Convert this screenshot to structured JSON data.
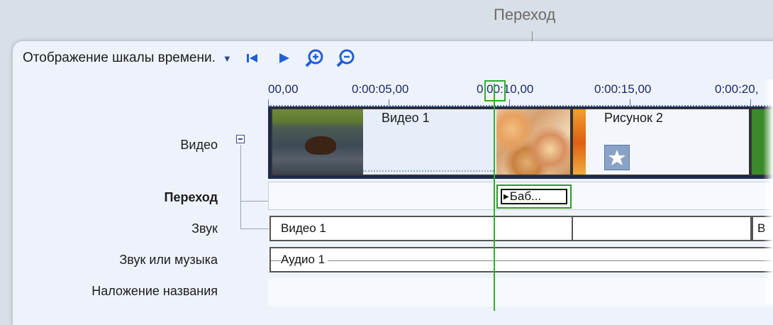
{
  "callout": {
    "label": "Переход"
  },
  "toolbar": {
    "timeline_view": "Отображение шкалы времени.",
    "icons": [
      "chevron-down-icon",
      "skip-back-icon",
      "play-icon",
      "zoom-in-icon",
      "zoom-out-icon"
    ]
  },
  "ruler": {
    "ticks": [
      "00,00",
      "0:00:05,00",
      "0:00:10,00",
      "0:00:15,00",
      "0:00:20,"
    ]
  },
  "tracks": {
    "video": "Видео",
    "transition": "Переход",
    "audio": "Звук",
    "audio_music": "Звук или музыка",
    "title_overlay": "Наложение названия"
  },
  "clips": {
    "video1": "Видео 1",
    "image2": "Рисунок 2",
    "transition": "Баб...",
    "audio_video1": "Видео 1",
    "audio_next": "В",
    "music1": "Аудио 1"
  },
  "colors": {
    "playhead": "#2fae2f",
    "ruler_text": "#1d2a6b",
    "panel": "#eef3fb"
  }
}
